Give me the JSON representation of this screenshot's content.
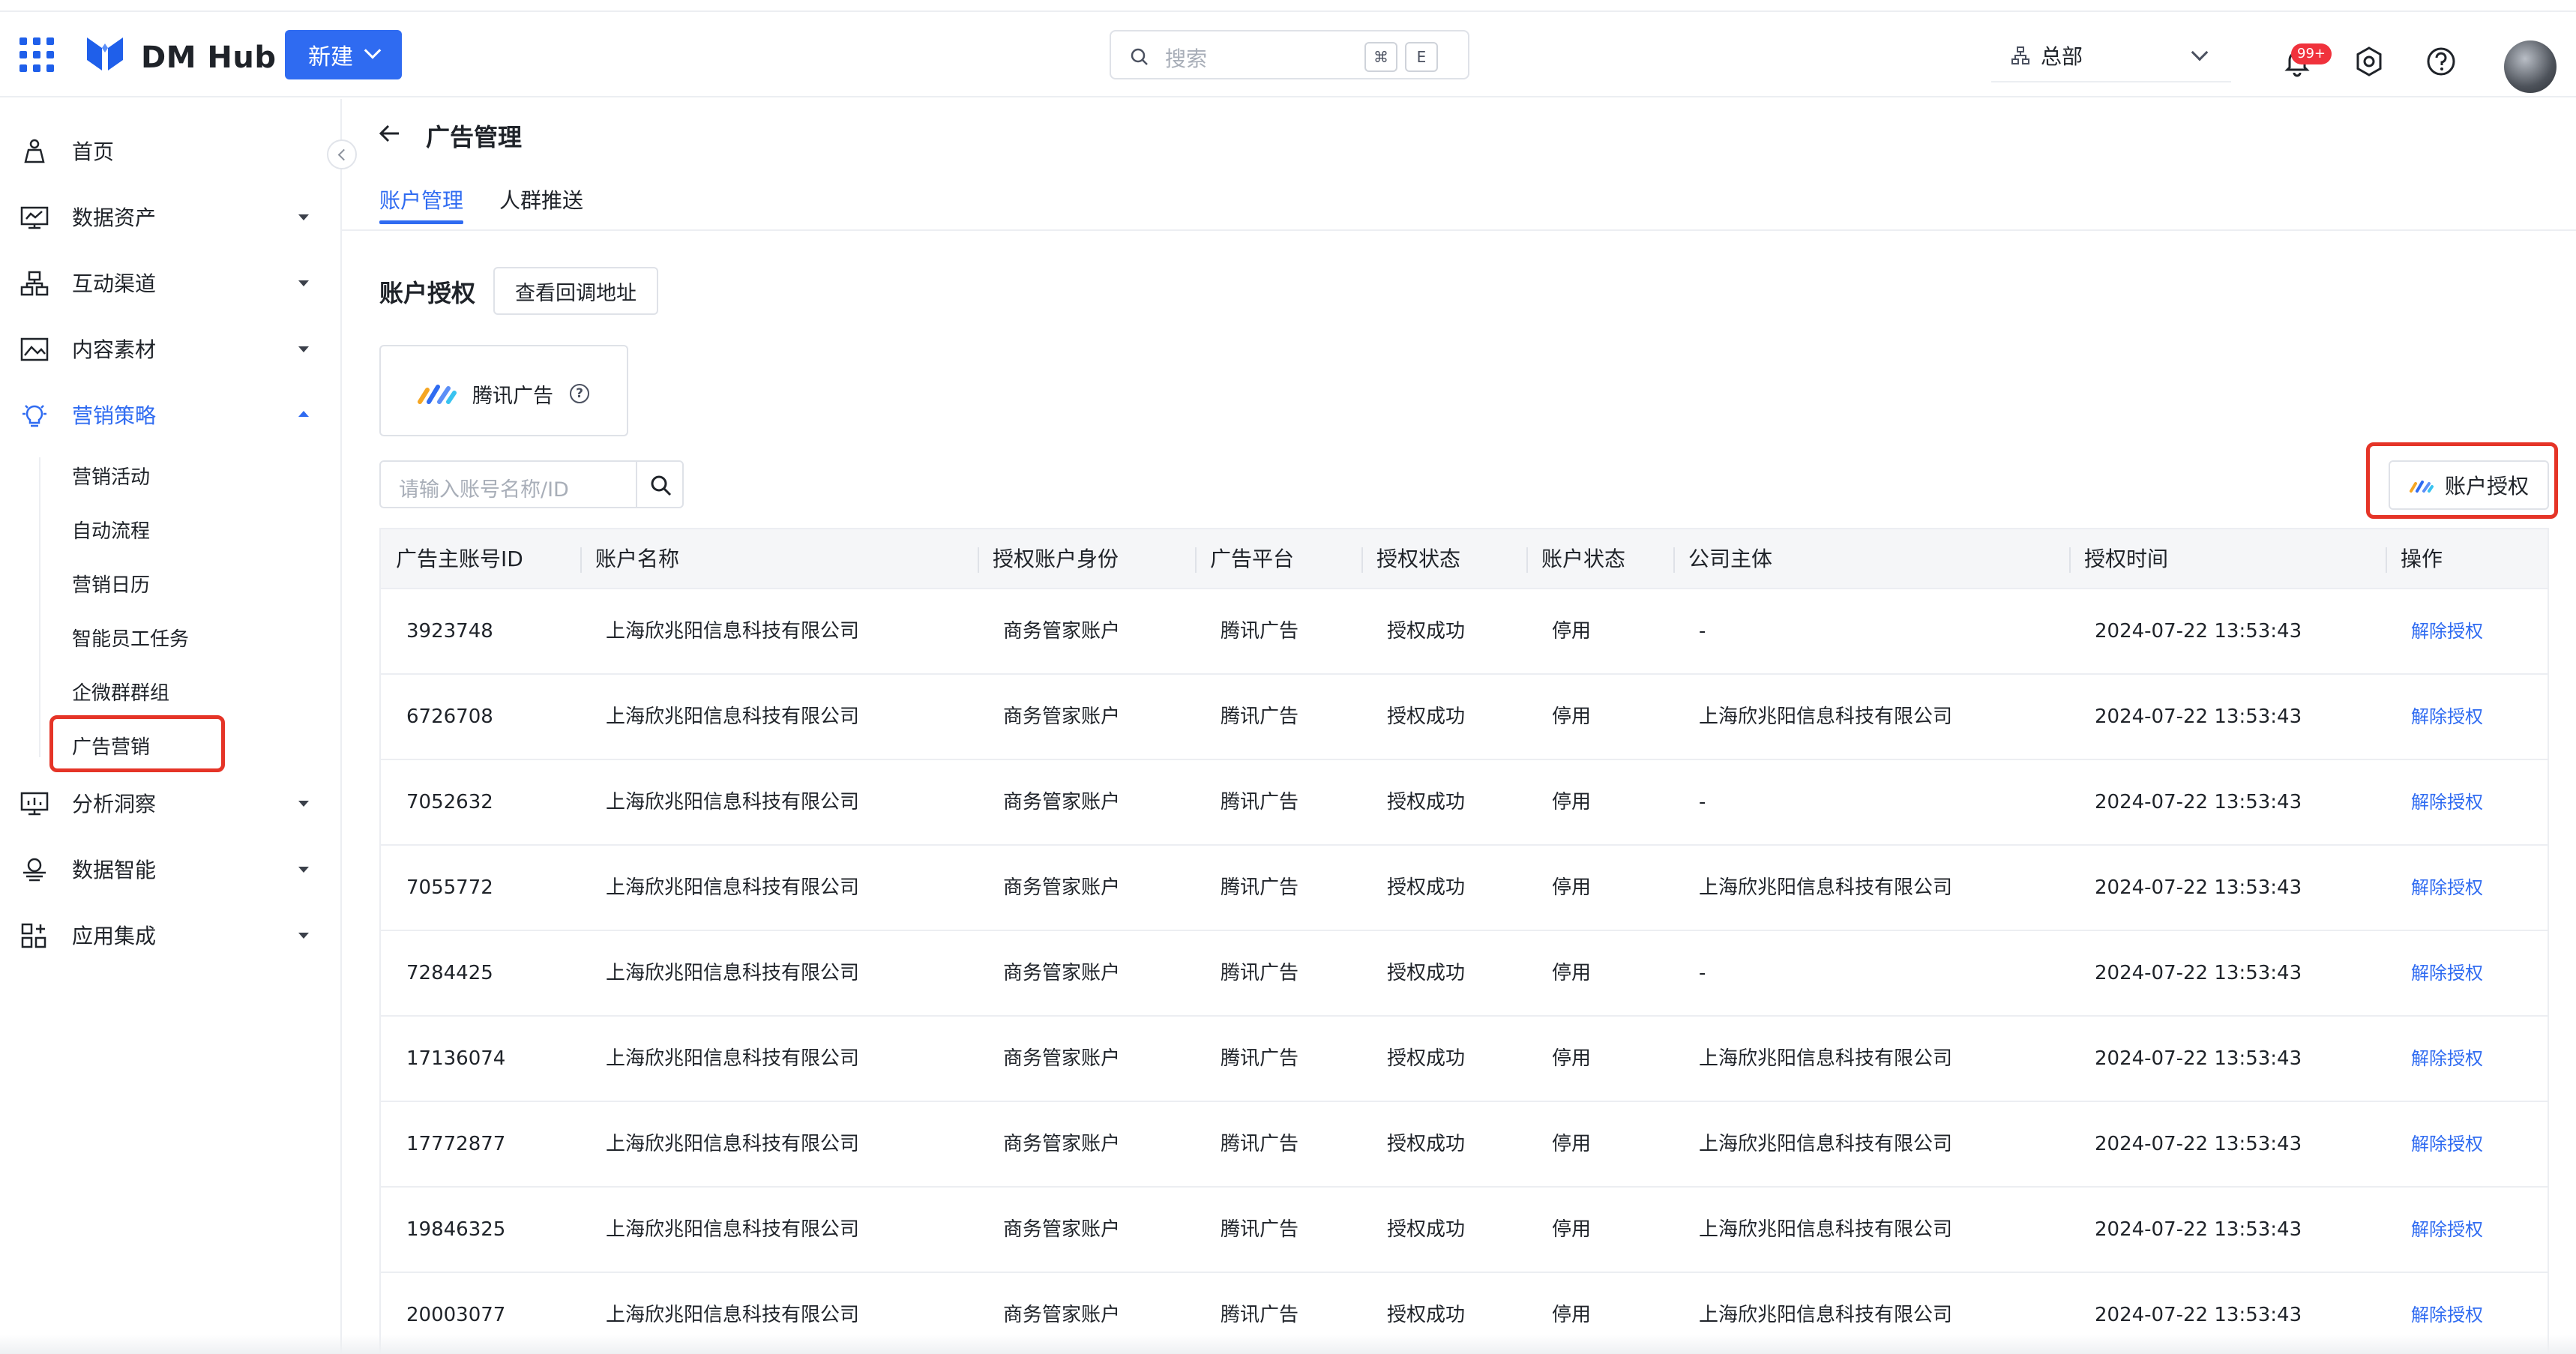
{
  "app": {
    "brand": "DM Hub",
    "new_button": "新建",
    "search_placeholder": "搜索",
    "shortcut_keys": [
      "⌘",
      "E"
    ],
    "org": "总部",
    "notification_badge": "99+"
  },
  "sidebar": {
    "items": [
      {
        "label": "首页",
        "icon": "home-icon"
      },
      {
        "label": "数据资产",
        "icon": "data-asset-icon"
      },
      {
        "label": "互动渠道",
        "icon": "channel-icon"
      },
      {
        "label": "内容素材",
        "icon": "content-icon"
      },
      {
        "label": "营销策略",
        "icon": "strategy-icon"
      },
      {
        "label": "分析洞察",
        "icon": "analysis-icon"
      },
      {
        "label": "数据智能",
        "icon": "data-intel-icon"
      },
      {
        "label": "应用集成",
        "icon": "integration-icon"
      }
    ],
    "sub_items": [
      "营销活动",
      "自动流程",
      "营销日历",
      "智能员工任务",
      "企微群群组",
      "广告营销"
    ]
  },
  "page": {
    "title": "广告管理",
    "tabs": [
      "账户管理",
      "人群推送"
    ],
    "section_title": "账户授权",
    "callback_button": "查看回调地址",
    "platform_card_label": "腾讯广告",
    "search_placeholder": "请输入账号名称/ID",
    "auth_button": "账户授权"
  },
  "table": {
    "columns": [
      "广告主账号ID",
      "账户名称",
      "授权账户身份",
      "广告平台",
      "授权状态",
      "账户状态",
      "公司主体",
      "授权时间",
      "操作"
    ],
    "rows": [
      [
        "3923748",
        "上海欣兆阳信息科技有限公司",
        "商务管家账户",
        "腾讯广告",
        "授权成功",
        "停用",
        "-",
        "2024-07-22 13:53:43",
        "解除授权"
      ],
      [
        "6726708",
        "上海欣兆阳信息科技有限公司",
        "商务管家账户",
        "腾讯广告",
        "授权成功",
        "停用",
        "上海欣兆阳信息科技有限公司",
        "2024-07-22 13:53:43",
        "解除授权"
      ],
      [
        "7052632",
        "上海欣兆阳信息科技有限公司",
        "商务管家账户",
        "腾讯广告",
        "授权成功",
        "停用",
        "-",
        "2024-07-22 13:53:43",
        "解除授权"
      ],
      [
        "7055772",
        "上海欣兆阳信息科技有限公司",
        "商务管家账户",
        "腾讯广告",
        "授权成功",
        "停用",
        "上海欣兆阳信息科技有限公司",
        "2024-07-22 13:53:43",
        "解除授权"
      ],
      [
        "7284425",
        "上海欣兆阳信息科技有限公司",
        "商务管家账户",
        "腾讯广告",
        "授权成功",
        "停用",
        "-",
        "2024-07-22 13:53:43",
        "解除授权"
      ],
      [
        "17136074",
        "上海欣兆阳信息科技有限公司",
        "商务管家账户",
        "腾讯广告",
        "授权成功",
        "停用",
        "上海欣兆阳信息科技有限公司",
        "2024-07-22 13:53:43",
        "解除授权"
      ],
      [
        "17772877",
        "上海欣兆阳信息科技有限公司",
        "商务管家账户",
        "腾讯广告",
        "授权成功",
        "停用",
        "上海欣兆阳信息科技有限公司",
        "2024-07-22 13:53:43",
        "解除授权"
      ],
      [
        "19846325",
        "上海欣兆阳信息科技有限公司",
        "商务管家账户",
        "腾讯广告",
        "授权成功",
        "停用",
        "上海欣兆阳信息科技有限公司",
        "2024-07-22 13:53:43",
        "解除授权"
      ],
      [
        "20003077",
        "上海欣兆阳信息科技有限公司",
        "商务管家账户",
        "腾讯广告",
        "授权成功",
        "停用",
        "上海欣兆阳信息科技有限公司",
        "2024-07-22 13:53:43",
        "解除授权"
      ]
    ]
  },
  "colors": {
    "primary": "#2f6bf1",
    "highlight": "#e53427",
    "badge": "#f0323c"
  }
}
